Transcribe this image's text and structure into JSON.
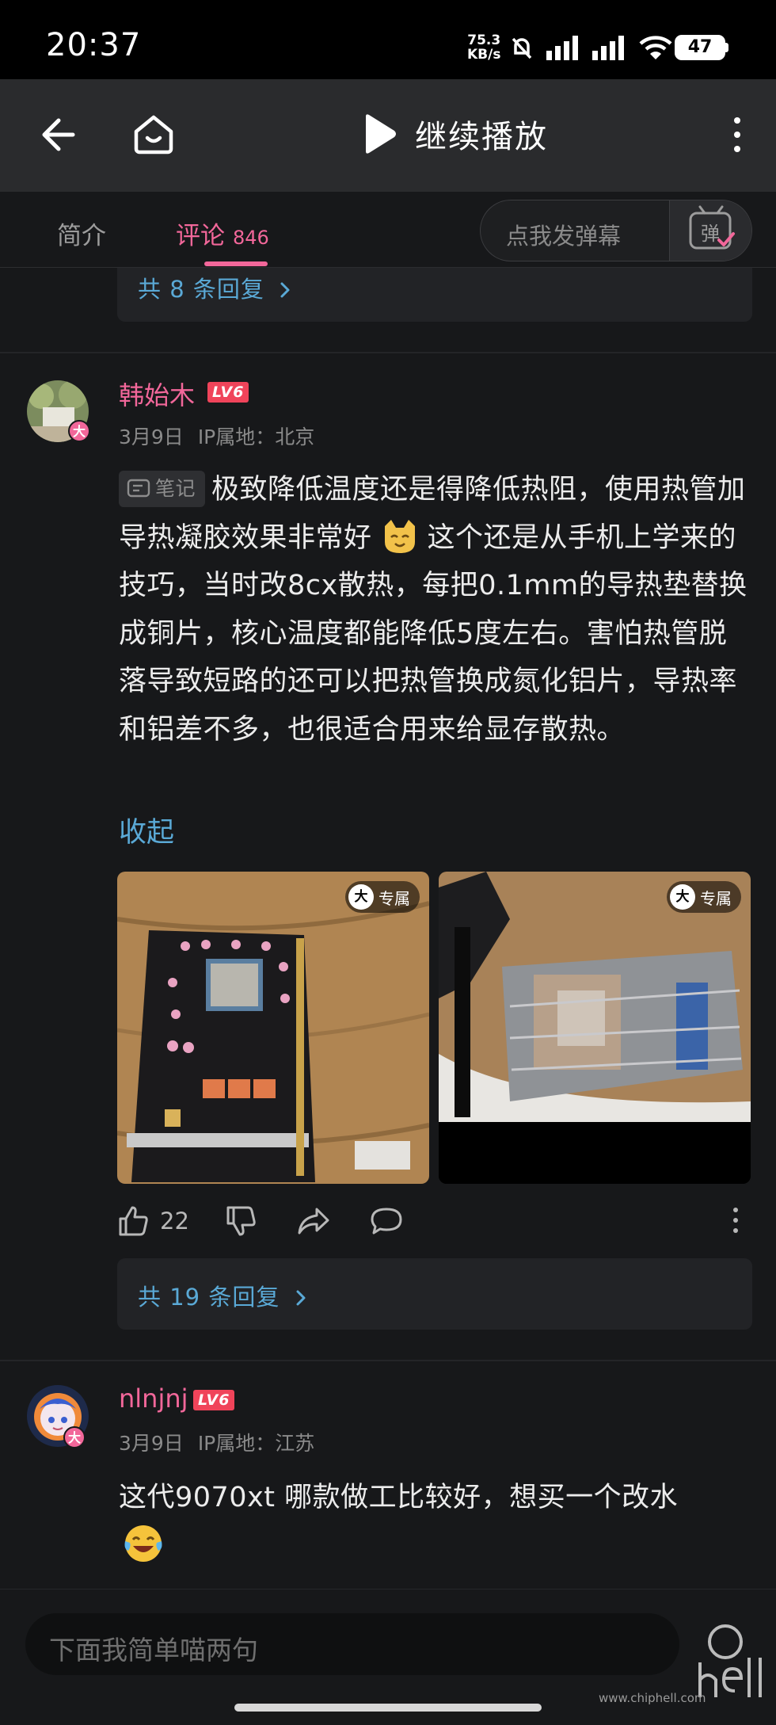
{
  "status_bar": {
    "time": "20:37",
    "net_speed_value": "75.3",
    "net_speed_unit": "KB/s",
    "battery": "47"
  },
  "top_bar": {
    "continue_label": "继续播放"
  },
  "tabs": {
    "intro_label": "简介",
    "comments_label": "评论",
    "comments_count": "846",
    "danmaku_placeholder": "点我发弹幕",
    "danmaku_button_glyph": "弹"
  },
  "feed": {
    "prev_reply_link": "共 8 条回复",
    "comments": [
      {
        "username": "韩始木",
        "level": "LV6",
        "badge": "大",
        "date": "3月9日",
        "ip_location": "IP属地：北京",
        "note_tag": "笔记",
        "text_part1": "极致降低温度还是得降低热阻，使用热管加导热凝胶效果非常好",
        "text_part2": "这个还是从手机上学来的技巧，当时改8cx散热，每把0.1mm的导热垫替换成铜片，核心温度都能降低5度左右。害怕热管脱落导致短路的还可以把热管换成氮化铝片，导热率和铝差不多，也很适合用来给显存散热。",
        "collapse_label": "收起",
        "images": [
          {
            "badge_glyph": "大",
            "badge_label": "专属"
          },
          {
            "badge_glyph": "大",
            "badge_label": "专属"
          }
        ],
        "likes": "22",
        "reply_link": "共 19 条回复"
      },
      {
        "username": "nlnjnj",
        "level": "LV6",
        "badge": "大",
        "date": "3月9日",
        "ip_location": "IP属地：江苏",
        "text": "这代9070xt 哪款做工比较好，想买一个改水"
      }
    ]
  },
  "bottom_bar": {
    "input_placeholder": "下面我简单喵两句",
    "watermark_text": "www.chiphell.com"
  },
  "colors": {
    "accent_pink": "#f2679a",
    "link_blue": "#5aa9d6",
    "background": "#17181a",
    "level_badge": "#f0445a"
  },
  "icons": [
    "back-arrow-icon",
    "home-icon",
    "play-icon",
    "more-vertical-icon",
    "danmaku-icon",
    "thumb-up-icon",
    "thumb-down-icon",
    "share-icon",
    "reply-bubble-icon",
    "chevron-right-icon"
  ]
}
